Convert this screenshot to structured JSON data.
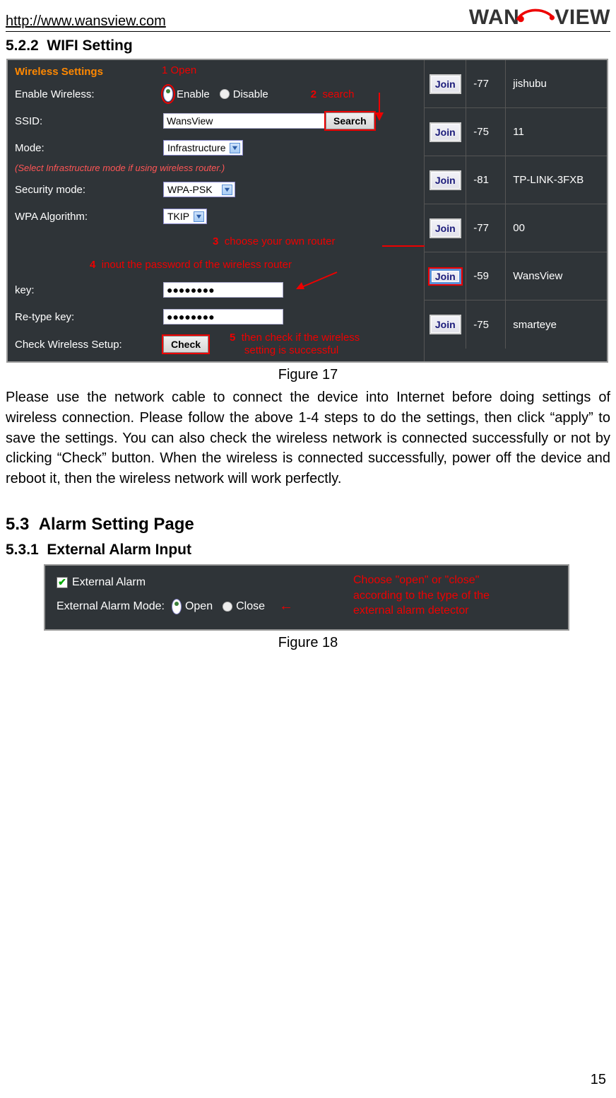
{
  "header": {
    "url": "http://www.wansview.com",
    "logo_prefix": "WAN",
    "logo_s": "S",
    "logo_suffix": "VIEW"
  },
  "sec522": {
    "num": "5.2.2",
    "title": "WIFI Setting"
  },
  "wireless": {
    "title": "Wireless Settings",
    "enable_label": "Enable Wireless:",
    "enable_opt": "Enable",
    "disable_opt": "Disable",
    "ssid_label": "SSID:",
    "ssid_value": "WansView",
    "search_btn": "Search",
    "mode_label": "Mode:",
    "mode_value": "Infrastructure",
    "infra_note": "(Select Infrastructure mode if using wireless router.)",
    "security_label": "Security mode:",
    "security_value": "WPA-PSK",
    "wpa_label": "WPA Algorithm:",
    "wpa_value": "TKIP",
    "key_label": "key:",
    "key_value": "●●●●●●●●",
    "retype_label": "Re-type key:",
    "retype_value": "●●●●●●●●",
    "check_label": "Check Wireless Setup:",
    "check_btn": "Check"
  },
  "annotations": {
    "a1": "1 Open",
    "a2n": "2",
    "a2t": "search",
    "a3n": "3",
    "a3t": "choose your own router",
    "a4n": "4",
    "a4t": "inout the password of the wireless router",
    "a5n": "5",
    "a5t1": "then check if the wireless",
    "a5t2": "setting is successful"
  },
  "networks": [
    {
      "signal": "-77",
      "name": "jishubu"
    },
    {
      "signal": "-75",
      "name": "11"
    },
    {
      "signal": "-81",
      "name": "TP-LINK-3FXB"
    },
    {
      "signal": "-77",
      "name": "00"
    },
    {
      "signal": "-59",
      "name": "WansView"
    },
    {
      "signal": "-75",
      "name": "smarteye"
    }
  ],
  "join_label": "Join",
  "fig17_caption": "Figure 17",
  "body17": "Please use the network cable to connect the device into Internet before doing settings of wireless connection. Please follow the above 1-4 steps to do the settings, then click “apply” to save the settings. You can also check the wireless network is connected successfully or not by clicking “Check” button. When the wireless is connected successfully, power off the device and reboot it, then the wireless network will work perfectly.",
  "sec53": {
    "num": "5.3",
    "title": "Alarm Setting Page"
  },
  "sec531": {
    "num": "5.3.1",
    "title": "External Alarm Input"
  },
  "ext": {
    "ext_label": "External Alarm",
    "mode_label": "External Alarm Mode:",
    "open": "Open",
    "close": "Close",
    "note1": "Choose \"open\" or \"close\"",
    "note2": "according to the type of the",
    "note3": "external alarm detector"
  },
  "fig18_caption": "Figure 18",
  "page_number": "15"
}
